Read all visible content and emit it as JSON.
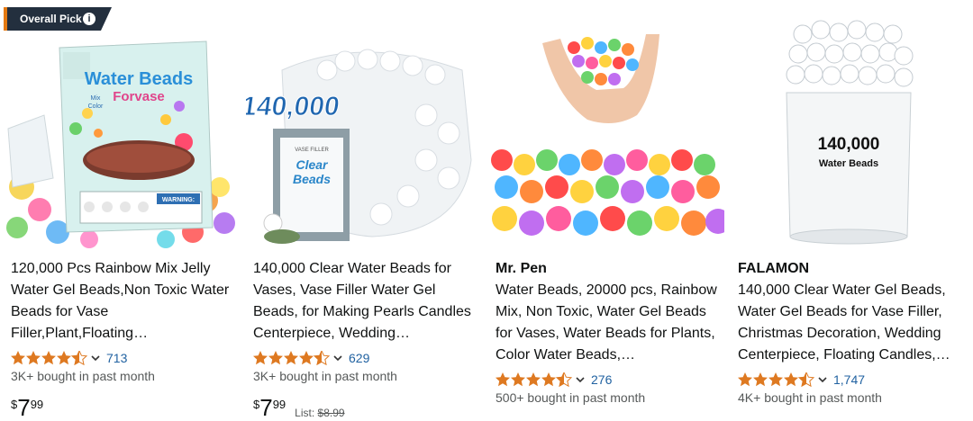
{
  "badge": {
    "label": "Overall Pick",
    "info_icon": "i"
  },
  "products": [
    {
      "brand": "",
      "title": "120,000 Pcs Rainbow Mix Jelly Water Gel Beads,Non Toxic Water Beads for Vase Filler,Plant,Floating…",
      "image_text": [
        "Water Beads",
        "Forvase",
        "Mix",
        "Color",
        "WARNING:"
      ],
      "rating": 4.5,
      "reviews": "713",
      "bought": "3K+ bought in past month",
      "price_symbol": "$",
      "price_whole": "7",
      "price_fraction": "99",
      "list_price": ""
    },
    {
      "brand": "",
      "title": "140,000 Clear Water Beads for Vases, Vase Filler Water Gel Beads, for Making Pearls Candles Centerpiece, Wedding…",
      "image_text": [
        "140,000",
        "VASE FILLER",
        "Clear",
        "Beads"
      ],
      "rating": 4.5,
      "reviews": "629",
      "bought": "3K+ bought in past month",
      "price_symbol": "$",
      "price_whole": "7",
      "price_fraction": "99",
      "list_label": "List:",
      "list_price": "$8.99"
    },
    {
      "brand": "Mr. Pen",
      "title": "Water Beads, 20000 pcs, Rainbow Mix, Non Toxic, Water Gel Beads for Vases, Water Beads for Plants, Color Water Beads,…",
      "rating": 4.5,
      "reviews": "276",
      "bought": "500+ bought in past month"
    },
    {
      "brand": "FALAMON",
      "title": "140,000 Clear Water Gel Beads, Water Gel Beads for Vase Filler, Christmas Decoration, Wedding Centerpiece, Floating Candles,…",
      "image_text": [
        "140,000",
        "Water Beads"
      ],
      "rating": 4.5,
      "reviews": "1,747",
      "bought": "4K+ bought in past month"
    }
  ],
  "colors": {
    "star": "#de7921",
    "link": "#2162a1",
    "badge": "#232f3e",
    "badge_accent": "#e47911"
  }
}
